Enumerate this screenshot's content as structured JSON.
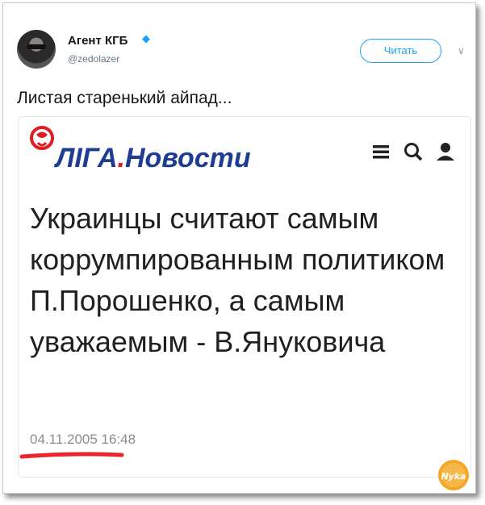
{
  "tweet": {
    "username": "Агент КГБ",
    "handle": "@zedolazer",
    "follow_label": "Читать",
    "text": "Листая старенький айпад..."
  },
  "article": {
    "logo_main": "ЛІГА",
    "logo_dot": ".",
    "logo_sub": "Новости",
    "headline": "Украинцы считают самым коррумпированным политиком П.Порошенко, а самым уважаемым - В.Януковича",
    "date": "04.11.2005 16:48"
  },
  "watermark": {
    "text": "Nyka"
  },
  "colors": {
    "twitter_blue": "#1da1f2",
    "liga_blue": "#1d3c92",
    "liga_red": "#e21b23",
    "underline_red": "#e8262b"
  }
}
